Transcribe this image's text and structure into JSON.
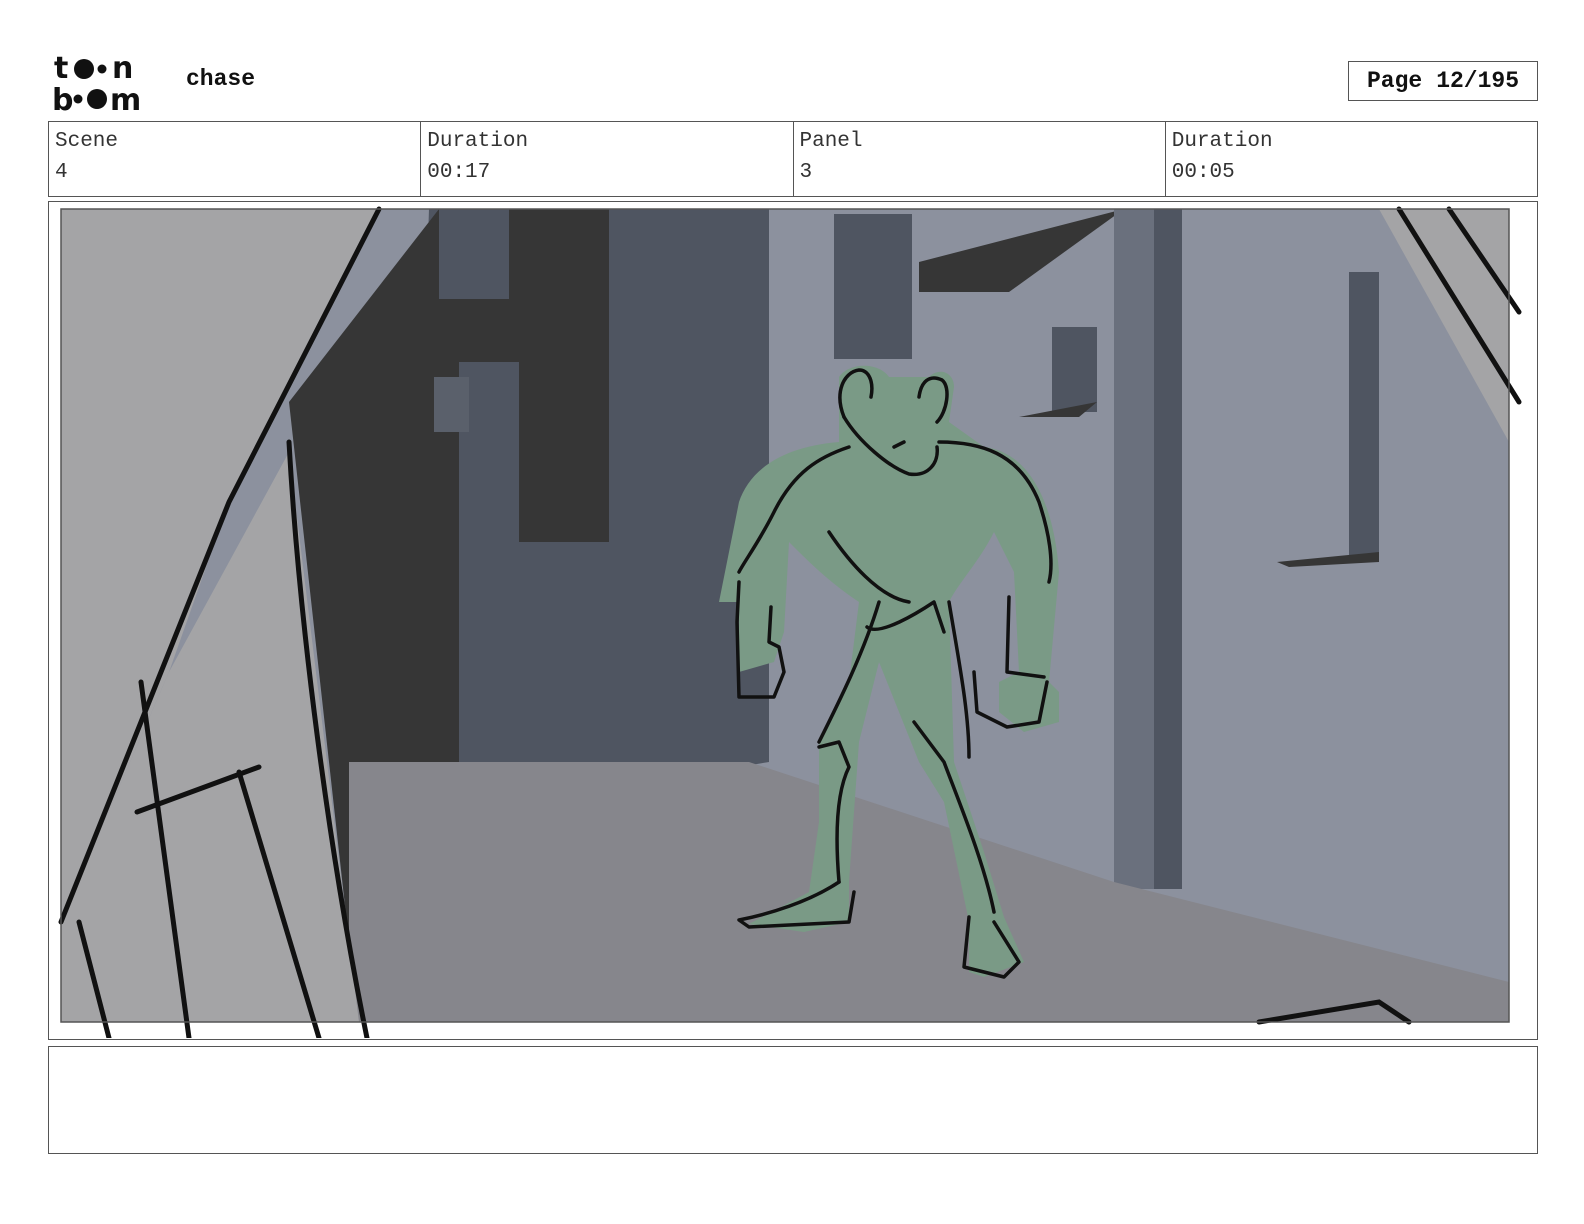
{
  "header": {
    "project_title": "chase",
    "page_label": "Page",
    "page_number": "12/195"
  },
  "info": {
    "scene_label": "Scene",
    "scene_value": "4",
    "scene_duration_label": "Duration",
    "scene_duration_value": "00:17",
    "panel_label": "Panel",
    "panel_value": "3",
    "panel_duration_label": "Duration",
    "panel_duration_value": "00:05"
  },
  "notes": {
    "text": ""
  },
  "colors": {
    "wall_light": "#8c919e",
    "wall_dark": "#4f5561",
    "shadow": "#363636",
    "floor": "#86868c",
    "foreground_wall": "#a4a4a6",
    "character_fill": "#7a9a86",
    "line": "#111111"
  }
}
